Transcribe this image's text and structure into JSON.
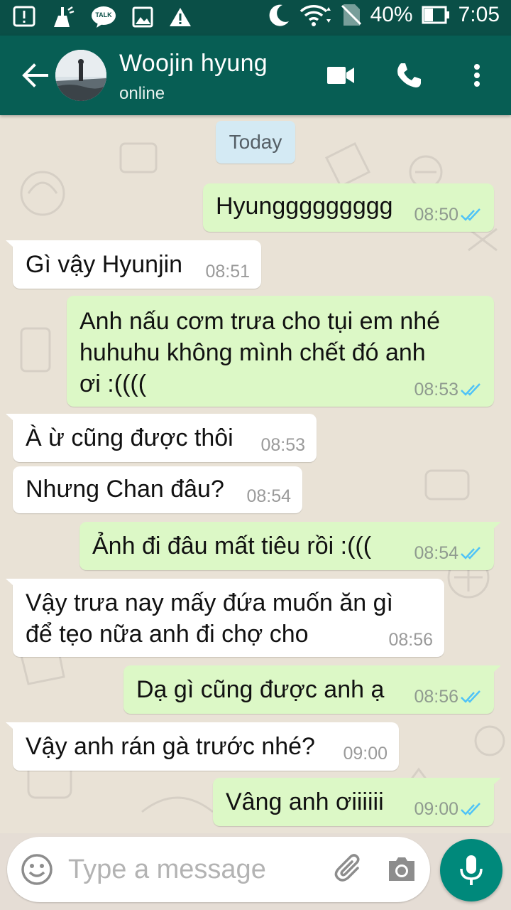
{
  "status_bar": {
    "battery": "40%",
    "time": "7:05",
    "icons": [
      "alert-box-icon",
      "cleaner-icon",
      "talk-icon",
      "image-icon",
      "warning-icon",
      "moon-icon",
      "wifi-icon",
      "no-sim-icon",
      "battery-icon"
    ],
    "talk_badge": "TALK"
  },
  "header": {
    "contact_name": "Woojin hyung",
    "status": "online",
    "actions": [
      "video-call-icon",
      "phone-call-icon",
      "more-options-icon"
    ]
  },
  "chat": {
    "date_chip": "Today",
    "messages": [
      {
        "dir": "out",
        "text": "Hyunggggggggg",
        "time": "08:50",
        "read": true
      },
      {
        "dir": "in",
        "text": "Gì vậy Hyunjin",
        "time": "08:51"
      },
      {
        "dir": "out",
        "lines": [
          "Anh nấu cơm trưa cho tụi em nhé",
          "huhuhu không mình chết đó anh",
          "ơi :(((("
        ],
        "time": "08:53",
        "read": true
      },
      {
        "dir": "in",
        "text": "À ừ cũng được thôi",
        "time": "08:53"
      },
      {
        "dir": "in",
        "text": "Nhưng Chan đâu?",
        "time": "08:54"
      },
      {
        "dir": "out",
        "text": "Ảnh đi đâu mất tiêu rồi :(((",
        "time": "08:54",
        "read": true
      },
      {
        "dir": "in",
        "lines": [
          "Vậy trưa nay mấy đứa muốn ăn gì",
          "để tẹo nữa anh đi chợ cho"
        ],
        "time": "08:56"
      },
      {
        "dir": "out",
        "text": "Dạ gì cũng được anh ạ",
        "time": "08:56",
        "read": true
      },
      {
        "dir": "in",
        "text": "Vậy anh rán gà trước nhé?",
        "time": "09:00"
      },
      {
        "dir": "out",
        "text": "Vâng anh ơiiiiii",
        "time": "09:00",
        "read": true
      }
    ]
  },
  "composer": {
    "placeholder": "Type a message",
    "icons": [
      "emoji-icon",
      "attach-icon",
      "camera-icon",
      "mic-icon"
    ]
  },
  "colors": {
    "header": "#075e54",
    "status_bar": "#0a4f47",
    "outgoing_bubble": "#dcf8c6",
    "incoming_bubble": "#ffffff",
    "read_tick": "#4fc3f7",
    "mic_button": "#00897b"
  }
}
